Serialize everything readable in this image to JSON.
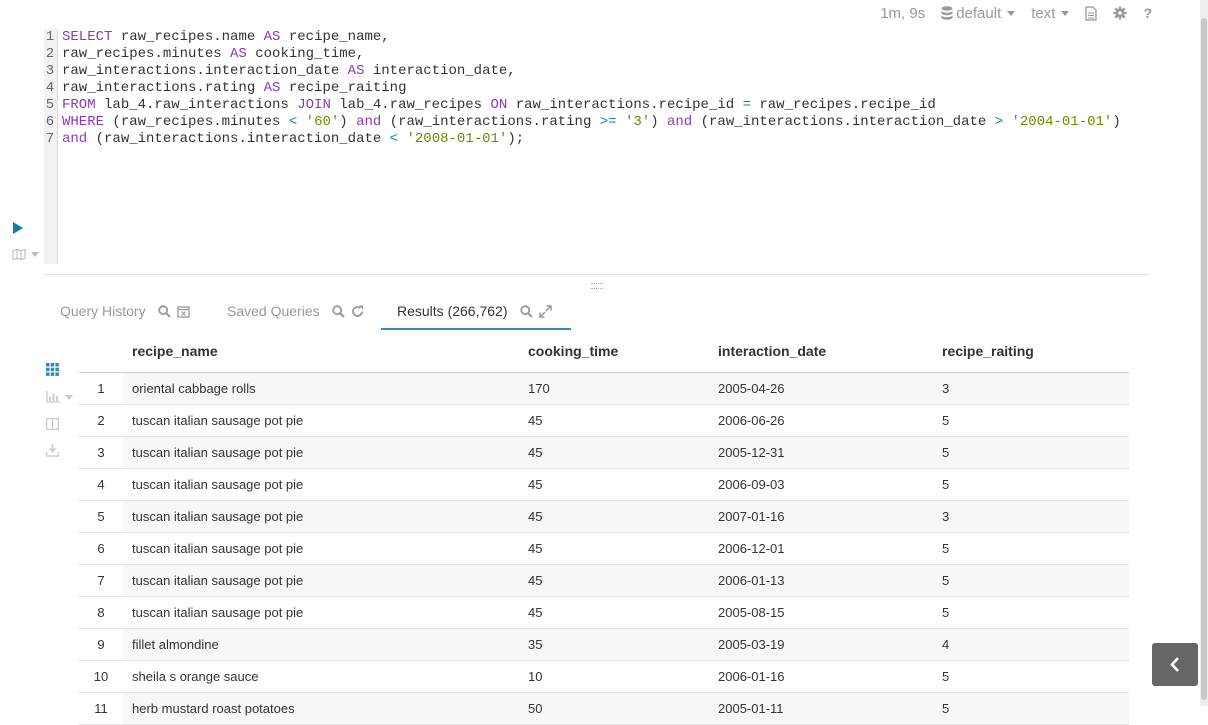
{
  "toolbar": {
    "execution_time": "1m, 9s",
    "database": "default",
    "format": "text"
  },
  "editor": {
    "lines": [
      {
        "num": "1",
        "tokens": [
          [
            "kw",
            "SELECT"
          ],
          [
            "t",
            " raw_recipes.name "
          ],
          [
            "kw",
            "AS"
          ],
          [
            "t",
            " recipe_name,"
          ]
        ]
      },
      {
        "num": "2",
        "tokens": [
          [
            "t",
            "raw_recipes.minutes "
          ],
          [
            "kw",
            "AS"
          ],
          [
            "t",
            " cooking_time,"
          ]
        ]
      },
      {
        "num": "3",
        "tokens": [
          [
            "t",
            "raw_interactions.interaction_date "
          ],
          [
            "kw",
            "AS"
          ],
          [
            "t",
            " interaction_date,"
          ]
        ]
      },
      {
        "num": "4",
        "tokens": [
          [
            "t",
            "raw_interactions.rating "
          ],
          [
            "kw",
            "AS"
          ],
          [
            "t",
            " recipe_raiting"
          ]
        ]
      },
      {
        "num": "5",
        "tokens": [
          [
            "kw",
            "FROM"
          ],
          [
            "t",
            " lab_4.raw_interactions "
          ],
          [
            "kw",
            "JOIN"
          ],
          [
            "t",
            " lab_4.raw_recipes "
          ],
          [
            "kw",
            "ON"
          ],
          [
            "t",
            " raw_interactions.recipe_id "
          ],
          [
            "op",
            "="
          ],
          [
            "t",
            " raw_recipes.recipe_id"
          ]
        ]
      },
      {
        "num": "6",
        "tokens": [
          [
            "kw",
            "WHERE"
          ],
          [
            "t",
            " (raw_recipes.minutes "
          ],
          [
            "op",
            "<"
          ],
          [
            "t",
            " "
          ],
          [
            "str",
            "'60'"
          ],
          [
            "t",
            ") "
          ],
          [
            "kw",
            "and"
          ],
          [
            "t",
            " (raw_interactions.rating "
          ],
          [
            "op",
            ">="
          ],
          [
            "t",
            " "
          ],
          [
            "str",
            "'3'"
          ],
          [
            "t",
            ") "
          ],
          [
            "kw",
            "and"
          ],
          [
            "t",
            " (raw_interactions.interaction_date "
          ],
          [
            "op",
            ">"
          ],
          [
            "t",
            " "
          ],
          [
            "str",
            "'2004-01-01'"
          ],
          [
            "t",
            ")"
          ]
        ]
      },
      {
        "num": "7",
        "tokens": [
          [
            "kw",
            "and"
          ],
          [
            "t",
            " (raw_interactions.interaction_date "
          ],
          [
            "op",
            "<"
          ],
          [
            "t",
            " "
          ],
          [
            "str",
            "'2008-01-01'"
          ],
          [
            "t",
            ");"
          ]
        ]
      }
    ]
  },
  "tabs": {
    "history": "Query History",
    "saved": "Saved Queries",
    "results": "Results (266,762)"
  },
  "results": {
    "columns": [
      "recipe_name",
      "cooking_time",
      "interaction_date",
      "recipe_raiting"
    ],
    "rows": [
      [
        "1",
        "oriental cabbage rolls",
        "170",
        "2005-04-26",
        "3"
      ],
      [
        "2",
        "tuscan italian sausage pot pie",
        "45",
        "2006-06-26",
        "5"
      ],
      [
        "3",
        "tuscan italian sausage pot pie",
        "45",
        "2005-12-31",
        "5"
      ],
      [
        "4",
        "tuscan italian sausage pot pie",
        "45",
        "2006-09-03",
        "5"
      ],
      [
        "5",
        "tuscan italian sausage pot pie",
        "45",
        "2007-01-16",
        "3"
      ],
      [
        "6",
        "tuscan italian sausage pot pie",
        "45",
        "2006-12-01",
        "5"
      ],
      [
        "7",
        "tuscan italian sausage pot pie",
        "45",
        "2006-01-13",
        "5"
      ],
      [
        "8",
        "tuscan italian sausage pot pie",
        "45",
        "2005-08-15",
        "5"
      ],
      [
        "9",
        "fillet almondine",
        "35",
        "2005-03-19",
        "4"
      ],
      [
        "10",
        "sheila s orange sauce",
        "10",
        "2006-01-16",
        "5"
      ],
      [
        "11",
        "herb mustard roast potatoes",
        "50",
        "2005-01-11",
        "5"
      ]
    ]
  },
  "colors": {
    "keyword": "#8a3ab9",
    "operator": "#0d7fc2",
    "string": "#6a8b00",
    "accent": "#338bb8"
  }
}
